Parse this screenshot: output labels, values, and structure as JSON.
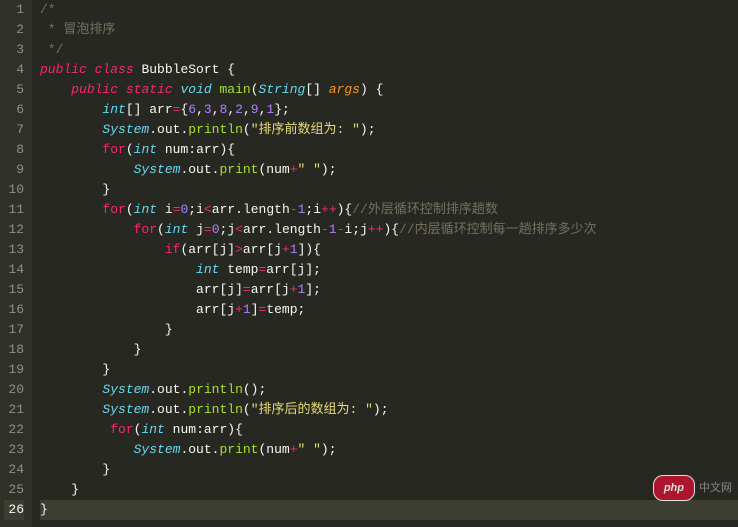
{
  "editor": {
    "active_line": 26,
    "lines": {
      "1": {
        "num": "1",
        "tokens": [
          {
            "cls": "c-comment",
            "t": "/*"
          }
        ]
      },
      "2": {
        "num": "2",
        "tokens": [
          {
            "cls": "c-comment",
            "t": " * 冒泡排序"
          }
        ]
      },
      "3": {
        "num": "3",
        "tokens": [
          {
            "cls": "c-comment",
            "t": " */"
          }
        ]
      },
      "4": {
        "num": "4",
        "tokens": [
          {
            "cls": "c-keyword",
            "t": "public"
          },
          {
            "cls": "c-default",
            "t": " "
          },
          {
            "cls": "c-keyword",
            "t": "class"
          },
          {
            "cls": "c-default",
            "t": " "
          },
          {
            "cls": "c-name",
            "t": "BubbleSort "
          },
          {
            "cls": "c-punct",
            "t": "{"
          }
        ]
      },
      "5": {
        "num": "5",
        "tokens": [
          {
            "cls": "c-default",
            "t": "    "
          },
          {
            "cls": "c-keyword",
            "t": "public"
          },
          {
            "cls": "c-default",
            "t": " "
          },
          {
            "cls": "c-keyword",
            "t": "static"
          },
          {
            "cls": "c-default",
            "t": " "
          },
          {
            "cls": "c-type",
            "t": "void"
          },
          {
            "cls": "c-default",
            "t": " "
          },
          {
            "cls": "c-func",
            "t": "main"
          },
          {
            "cls": "c-punct",
            "t": "("
          },
          {
            "cls": "c-type",
            "t": "String"
          },
          {
            "cls": "c-punct",
            "t": "[] "
          },
          {
            "cls": "c-var",
            "t": "args"
          },
          {
            "cls": "c-punct",
            "t": ") {"
          }
        ]
      },
      "6": {
        "num": "6",
        "tokens": [
          {
            "cls": "c-default",
            "t": "        "
          },
          {
            "cls": "c-type",
            "t": "int"
          },
          {
            "cls": "c-punct",
            "t": "[] "
          },
          {
            "cls": "c-name",
            "t": "arr"
          },
          {
            "cls": "c-op",
            "t": "="
          },
          {
            "cls": "c-punct",
            "t": "{"
          },
          {
            "cls": "c-num",
            "t": "6"
          },
          {
            "cls": "c-punct",
            "t": ","
          },
          {
            "cls": "c-num",
            "t": "3"
          },
          {
            "cls": "c-punct",
            "t": ","
          },
          {
            "cls": "c-num",
            "t": "8"
          },
          {
            "cls": "c-punct",
            "t": ","
          },
          {
            "cls": "c-num",
            "t": "2"
          },
          {
            "cls": "c-punct",
            "t": ","
          },
          {
            "cls": "c-num",
            "t": "9"
          },
          {
            "cls": "c-punct",
            "t": ","
          },
          {
            "cls": "c-num",
            "t": "1"
          },
          {
            "cls": "c-punct",
            "t": "};"
          }
        ]
      },
      "7": {
        "num": "7",
        "tokens": [
          {
            "cls": "c-default",
            "t": "        "
          },
          {
            "cls": "c-type",
            "t": "System"
          },
          {
            "cls": "c-punct",
            "t": "."
          },
          {
            "cls": "c-name",
            "t": "out"
          },
          {
            "cls": "c-punct",
            "t": "."
          },
          {
            "cls": "c-func",
            "t": "println"
          },
          {
            "cls": "c-punct",
            "t": "("
          },
          {
            "cls": "c-string",
            "t": "\"排序前数组为: \""
          },
          {
            "cls": "c-punct",
            "t": ");"
          }
        ]
      },
      "8": {
        "num": "8",
        "tokens": [
          {
            "cls": "c-default",
            "t": "        "
          },
          {
            "cls": "c-keyword2",
            "t": "for"
          },
          {
            "cls": "c-punct",
            "t": "("
          },
          {
            "cls": "c-type",
            "t": "int"
          },
          {
            "cls": "c-default",
            "t": " "
          },
          {
            "cls": "c-name",
            "t": "num"
          },
          {
            "cls": "c-punct",
            "t": ":"
          },
          {
            "cls": "c-name",
            "t": "arr"
          },
          {
            "cls": "c-punct",
            "t": "){"
          }
        ]
      },
      "9": {
        "num": "9",
        "tokens": [
          {
            "cls": "c-default",
            "t": "            "
          },
          {
            "cls": "c-type",
            "t": "System"
          },
          {
            "cls": "c-punct",
            "t": "."
          },
          {
            "cls": "c-name",
            "t": "out"
          },
          {
            "cls": "c-punct",
            "t": "."
          },
          {
            "cls": "c-func",
            "t": "print"
          },
          {
            "cls": "c-punct",
            "t": "("
          },
          {
            "cls": "c-name",
            "t": "num"
          },
          {
            "cls": "c-op",
            "t": "+"
          },
          {
            "cls": "c-string",
            "t": "\" \""
          },
          {
            "cls": "c-punct",
            "t": ");"
          }
        ]
      },
      "10": {
        "num": "10",
        "tokens": [
          {
            "cls": "c-default",
            "t": "        "
          },
          {
            "cls": "c-punct",
            "t": "}"
          }
        ]
      },
      "11": {
        "num": "11",
        "tokens": [
          {
            "cls": "c-default",
            "t": "        "
          },
          {
            "cls": "c-keyword2",
            "t": "for"
          },
          {
            "cls": "c-punct",
            "t": "("
          },
          {
            "cls": "c-type",
            "t": "int"
          },
          {
            "cls": "c-default",
            "t": " "
          },
          {
            "cls": "c-name",
            "t": "i"
          },
          {
            "cls": "c-op",
            "t": "="
          },
          {
            "cls": "c-num",
            "t": "0"
          },
          {
            "cls": "c-punct",
            "t": ";"
          },
          {
            "cls": "c-name",
            "t": "i"
          },
          {
            "cls": "c-op",
            "t": "<"
          },
          {
            "cls": "c-name",
            "t": "arr"
          },
          {
            "cls": "c-punct",
            "t": "."
          },
          {
            "cls": "c-name",
            "t": "length"
          },
          {
            "cls": "c-op",
            "t": "-"
          },
          {
            "cls": "c-num",
            "t": "1"
          },
          {
            "cls": "c-punct",
            "t": ";"
          },
          {
            "cls": "c-name",
            "t": "i"
          },
          {
            "cls": "c-op",
            "t": "++"
          },
          {
            "cls": "c-punct",
            "t": "){"
          },
          {
            "cls": "c-comment",
            "t": "//外层循环控制排序趟数"
          }
        ]
      },
      "12": {
        "num": "12",
        "tokens": [
          {
            "cls": "c-default",
            "t": "            "
          },
          {
            "cls": "c-keyword2",
            "t": "for"
          },
          {
            "cls": "c-punct",
            "t": "("
          },
          {
            "cls": "c-type",
            "t": "int"
          },
          {
            "cls": "c-default",
            "t": " "
          },
          {
            "cls": "c-name",
            "t": "j"
          },
          {
            "cls": "c-op",
            "t": "="
          },
          {
            "cls": "c-num",
            "t": "0"
          },
          {
            "cls": "c-punct",
            "t": ";"
          },
          {
            "cls": "c-name",
            "t": "j"
          },
          {
            "cls": "c-op",
            "t": "<"
          },
          {
            "cls": "c-name",
            "t": "arr"
          },
          {
            "cls": "c-punct",
            "t": "."
          },
          {
            "cls": "c-name",
            "t": "length"
          },
          {
            "cls": "c-op",
            "t": "-"
          },
          {
            "cls": "c-num",
            "t": "1"
          },
          {
            "cls": "c-op",
            "t": "-"
          },
          {
            "cls": "c-name",
            "t": "i"
          },
          {
            "cls": "c-punct",
            "t": ";"
          },
          {
            "cls": "c-name",
            "t": "j"
          },
          {
            "cls": "c-op",
            "t": "++"
          },
          {
            "cls": "c-punct",
            "t": "){"
          },
          {
            "cls": "c-comment",
            "t": "//内层循环控制每一趟排序多少次"
          }
        ]
      },
      "13": {
        "num": "13",
        "tokens": [
          {
            "cls": "c-default",
            "t": "                "
          },
          {
            "cls": "c-keyword2",
            "t": "if"
          },
          {
            "cls": "c-punct",
            "t": "("
          },
          {
            "cls": "c-name",
            "t": "arr"
          },
          {
            "cls": "c-punct",
            "t": "["
          },
          {
            "cls": "c-name",
            "t": "j"
          },
          {
            "cls": "c-punct",
            "t": "]"
          },
          {
            "cls": "c-op",
            "t": ">"
          },
          {
            "cls": "c-name",
            "t": "arr"
          },
          {
            "cls": "c-punct",
            "t": "["
          },
          {
            "cls": "c-name",
            "t": "j"
          },
          {
            "cls": "c-op",
            "t": "+"
          },
          {
            "cls": "c-num",
            "t": "1"
          },
          {
            "cls": "c-punct",
            "t": "]){"
          }
        ]
      },
      "14": {
        "num": "14",
        "tokens": [
          {
            "cls": "c-default",
            "t": "                    "
          },
          {
            "cls": "c-type",
            "t": "int"
          },
          {
            "cls": "c-default",
            "t": " "
          },
          {
            "cls": "c-name",
            "t": "temp"
          },
          {
            "cls": "c-op",
            "t": "="
          },
          {
            "cls": "c-name",
            "t": "arr"
          },
          {
            "cls": "c-punct",
            "t": "["
          },
          {
            "cls": "c-name",
            "t": "j"
          },
          {
            "cls": "c-punct",
            "t": "];"
          }
        ]
      },
      "15": {
        "num": "15",
        "tokens": [
          {
            "cls": "c-default",
            "t": "                    "
          },
          {
            "cls": "c-name",
            "t": "arr"
          },
          {
            "cls": "c-punct",
            "t": "["
          },
          {
            "cls": "c-name",
            "t": "j"
          },
          {
            "cls": "c-punct",
            "t": "]"
          },
          {
            "cls": "c-op",
            "t": "="
          },
          {
            "cls": "c-name",
            "t": "arr"
          },
          {
            "cls": "c-punct",
            "t": "["
          },
          {
            "cls": "c-name",
            "t": "j"
          },
          {
            "cls": "c-op",
            "t": "+"
          },
          {
            "cls": "c-num",
            "t": "1"
          },
          {
            "cls": "c-punct",
            "t": "];"
          }
        ]
      },
      "16": {
        "num": "16",
        "tokens": [
          {
            "cls": "c-default",
            "t": "                    "
          },
          {
            "cls": "c-name",
            "t": "arr"
          },
          {
            "cls": "c-punct",
            "t": "["
          },
          {
            "cls": "c-name",
            "t": "j"
          },
          {
            "cls": "c-op",
            "t": "+"
          },
          {
            "cls": "c-num",
            "t": "1"
          },
          {
            "cls": "c-punct",
            "t": "]"
          },
          {
            "cls": "c-op",
            "t": "="
          },
          {
            "cls": "c-name",
            "t": "temp"
          },
          {
            "cls": "c-punct",
            "t": ";"
          }
        ]
      },
      "17": {
        "num": "17",
        "tokens": [
          {
            "cls": "c-default",
            "t": "                "
          },
          {
            "cls": "c-punct",
            "t": "}"
          }
        ]
      },
      "18": {
        "num": "18",
        "tokens": [
          {
            "cls": "c-default",
            "t": "            "
          },
          {
            "cls": "c-punct",
            "t": "}"
          }
        ]
      },
      "19": {
        "num": "19",
        "tokens": [
          {
            "cls": "c-default",
            "t": "        "
          },
          {
            "cls": "c-punct",
            "t": "}"
          }
        ]
      },
      "20": {
        "num": "20",
        "tokens": [
          {
            "cls": "c-default",
            "t": "        "
          },
          {
            "cls": "c-type",
            "t": "System"
          },
          {
            "cls": "c-punct",
            "t": "."
          },
          {
            "cls": "c-name",
            "t": "out"
          },
          {
            "cls": "c-punct",
            "t": "."
          },
          {
            "cls": "c-func",
            "t": "println"
          },
          {
            "cls": "c-punct",
            "t": "();"
          }
        ]
      },
      "21": {
        "num": "21",
        "tokens": [
          {
            "cls": "c-default",
            "t": "        "
          },
          {
            "cls": "c-type",
            "t": "System"
          },
          {
            "cls": "c-punct",
            "t": "."
          },
          {
            "cls": "c-name",
            "t": "out"
          },
          {
            "cls": "c-punct",
            "t": "."
          },
          {
            "cls": "c-func",
            "t": "println"
          },
          {
            "cls": "c-punct",
            "t": "("
          },
          {
            "cls": "c-string",
            "t": "\"排序后的数组为: \""
          },
          {
            "cls": "c-punct",
            "t": ");"
          }
        ]
      },
      "22": {
        "num": "22",
        "tokens": [
          {
            "cls": "c-default",
            "t": "         "
          },
          {
            "cls": "c-keyword2",
            "t": "for"
          },
          {
            "cls": "c-punct",
            "t": "("
          },
          {
            "cls": "c-type",
            "t": "int"
          },
          {
            "cls": "c-default",
            "t": " "
          },
          {
            "cls": "c-name",
            "t": "num"
          },
          {
            "cls": "c-punct",
            "t": ":"
          },
          {
            "cls": "c-name",
            "t": "arr"
          },
          {
            "cls": "c-punct",
            "t": "){"
          }
        ]
      },
      "23": {
        "num": "23",
        "tokens": [
          {
            "cls": "c-default",
            "t": "            "
          },
          {
            "cls": "c-type",
            "t": "System"
          },
          {
            "cls": "c-punct",
            "t": "."
          },
          {
            "cls": "c-name",
            "t": "out"
          },
          {
            "cls": "c-punct",
            "t": "."
          },
          {
            "cls": "c-func",
            "t": "print"
          },
          {
            "cls": "c-punct",
            "t": "("
          },
          {
            "cls": "c-name",
            "t": "num"
          },
          {
            "cls": "c-op",
            "t": "+"
          },
          {
            "cls": "c-string",
            "t": "\" \""
          },
          {
            "cls": "c-punct",
            "t": ");"
          }
        ]
      },
      "24": {
        "num": "24",
        "tokens": [
          {
            "cls": "c-default",
            "t": "        "
          },
          {
            "cls": "c-punct",
            "t": "}"
          }
        ]
      },
      "25": {
        "num": "25",
        "tokens": [
          {
            "cls": "c-default",
            "t": "    "
          },
          {
            "cls": "c-punct",
            "t": "}"
          }
        ]
      },
      "26": {
        "num": "26",
        "tokens": [
          {
            "cls": "c-punct",
            "t": "}"
          }
        ]
      }
    }
  },
  "watermark": {
    "brand": "php",
    "suffix": "中文网"
  }
}
